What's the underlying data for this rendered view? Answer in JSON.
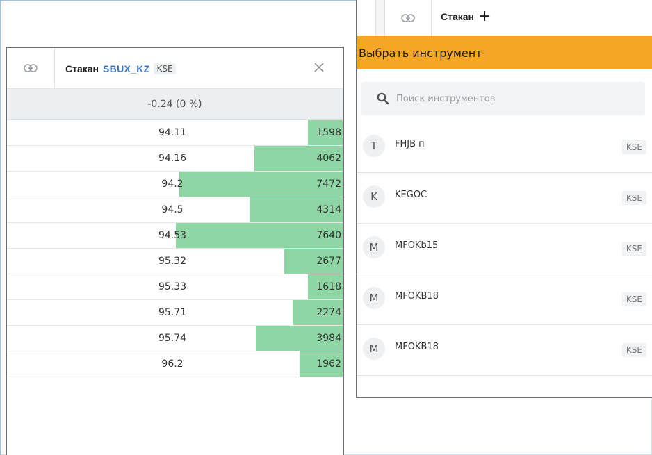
{
  "left_panel": {
    "title": "Стакан",
    "ticker": "SBUX_KZ",
    "exchange": "KSE",
    "change_text": "-0.24 (0 %)",
    "rows": [
      {
        "price": "94.11",
        "qty": "1598",
        "fill": 0.21
      },
      {
        "price": "94.16",
        "qty": "4062",
        "fill": 0.53
      },
      {
        "price": "94.2",
        "qty": "7472",
        "fill": 0.98
      },
      {
        "price": "94.5",
        "qty": "4314",
        "fill": 0.56
      },
      {
        "price": "94.53",
        "qty": "7640",
        "fill": 1.0
      },
      {
        "price": "95.32",
        "qty": "2677",
        "fill": 0.35
      },
      {
        "price": "95.33",
        "qty": "1618",
        "fill": 0.21
      },
      {
        "price": "95.71",
        "qty": "2274",
        "fill": 0.3
      },
      {
        "price": "95.74",
        "qty": "3984",
        "fill": 0.52
      },
      {
        "price": "96.2",
        "qty": "1962",
        "fill": 0.26
      }
    ],
    "bar_color": "#8fd6a5"
  },
  "right_panel": {
    "tab_title": "Стакан",
    "select_label": "Выбрать инструмент",
    "search_placeholder": "Поиск инструментов",
    "accent_color": "#f5a623",
    "instruments": [
      {
        "letter": "T",
        "name": "FHJB п",
        "exchange": "KSE"
      },
      {
        "letter": "K",
        "name": "KEGOC",
        "exchange": "KSE"
      },
      {
        "letter": "M",
        "name": "MFOKb15",
        "exchange": "KSE"
      },
      {
        "letter": "M",
        "name": "MFOKB18",
        "exchange": "KSE"
      },
      {
        "letter": "M",
        "name": "MFOKB18",
        "exchange": "KSE"
      }
    ]
  }
}
